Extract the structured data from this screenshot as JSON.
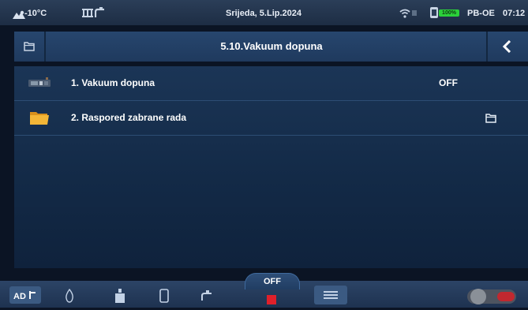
{
  "status_bar": {
    "temperature": "-10°C",
    "date": "Srijeda, 5.Lip.2024",
    "badge_text": "100%",
    "device_code": "PB-OE",
    "time": "07:12"
  },
  "header": {
    "title": "5.10.Vakuum dopuna",
    "folder_icon": "folder-outline-icon",
    "back_icon": "chevron-left-icon"
  },
  "menu_items": [
    {
      "label": "1.  Vakuum dopuna",
      "value": "OFF",
      "icon": "pump-unit-icon"
    },
    {
      "label": "2.  Raspored zabrane rada",
      "icon": "folder-icon",
      "action_icon": "folder-outline-icon"
    }
  ],
  "bottom_bar": {
    "mode_label": "OFF",
    "icons": [
      "heating-mode-icon",
      "flame-icon",
      "tank-icon",
      "boiler-icon",
      "tap-icon",
      "stop-icon",
      "menu-icon",
      "toggle-switch-icon"
    ]
  },
  "colors": {
    "background": "#0b1424",
    "header": "#27466e",
    "row_divider": "#2d4d74",
    "accent_green": "#2bd13a",
    "stop_red": "#e0202a"
  }
}
